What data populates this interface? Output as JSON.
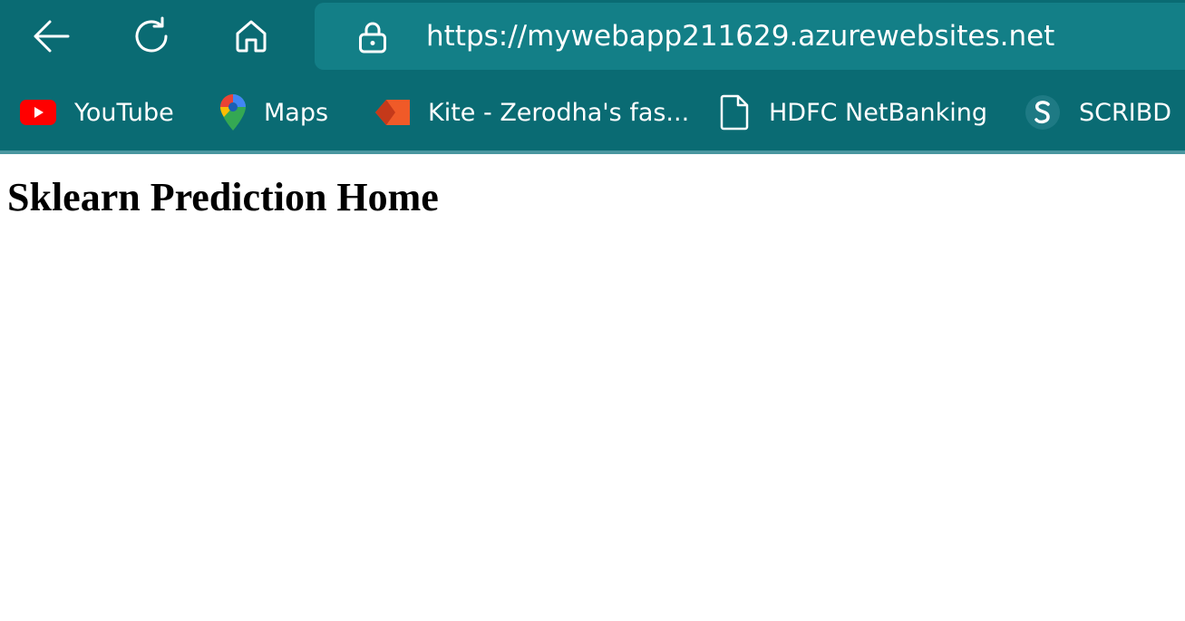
{
  "browser": {
    "address_bar": {
      "url": "https://mywebapp211629.azurewebsites.net"
    },
    "nav_icons": [
      "back-arrow-icon",
      "refresh-icon",
      "home-icon",
      "lock-icon"
    ],
    "bookmarks": [
      {
        "label": "YouTube",
        "icon": "youtube-icon"
      },
      {
        "label": "Maps",
        "icon": "google-maps-icon"
      },
      {
        "label": "Kite - Zerodha's fas...",
        "icon": "kite-icon"
      },
      {
        "label": "HDFC NetBanking",
        "icon": "document-icon"
      },
      {
        "label": "SCRIBD",
        "icon": "scribd-icon"
      }
    ]
  },
  "page": {
    "heading": "Sklearn Prediction Home"
  },
  "colors": {
    "chrome_background": "#0a6b73",
    "address_bar_background": "#137f87",
    "chrome_text": "#ffffff",
    "page_background": "#ffffff",
    "heading_text": "#000000"
  }
}
